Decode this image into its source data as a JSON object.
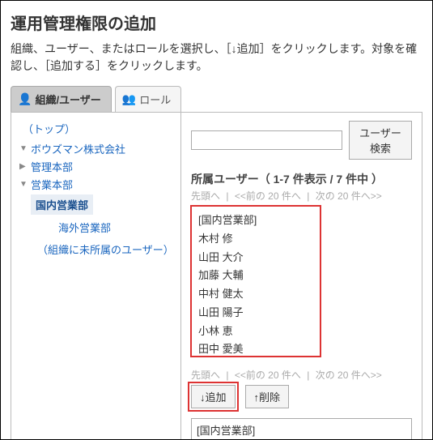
{
  "header": {
    "title": "運用管理権限の追加",
    "description": "組織、ユーザー、またはロールを選択し、［↓追加］をクリックします。対象を確認し、［追加する］をクリックします。"
  },
  "tabs": {
    "org_user": "組織/ユーザー",
    "role": "ロール"
  },
  "tree": {
    "top": "（トップ）",
    "company": "ボウズマン株式会社",
    "dept_admin": "管理本部",
    "dept_sales": "営業本部",
    "domestic": "国内営業部",
    "overseas": "海外営業部",
    "unassigned": "（組織に未所属のユーザー）"
  },
  "search": {
    "placeholder": "",
    "button": "ユーザー検索"
  },
  "list": {
    "title": "所属ユーザー（ 1-7 件表示 / 7 件中 ）",
    "pager_first": "先頭へ",
    "pager_prev": "<<前の 20 件へ",
    "pager_next": "次の 20 件へ>>",
    "sep": "|",
    "items": [
      "[国内営業部]",
      "木村 修",
      "山田 大介",
      "加藤 大輔",
      "中村 健太",
      "山田 陽子",
      "小林 恵",
      "田中 愛美"
    ]
  },
  "actions": {
    "add": "↓追加",
    "remove": "↑削除"
  },
  "selection": {
    "value": "[国内営業部]"
  }
}
